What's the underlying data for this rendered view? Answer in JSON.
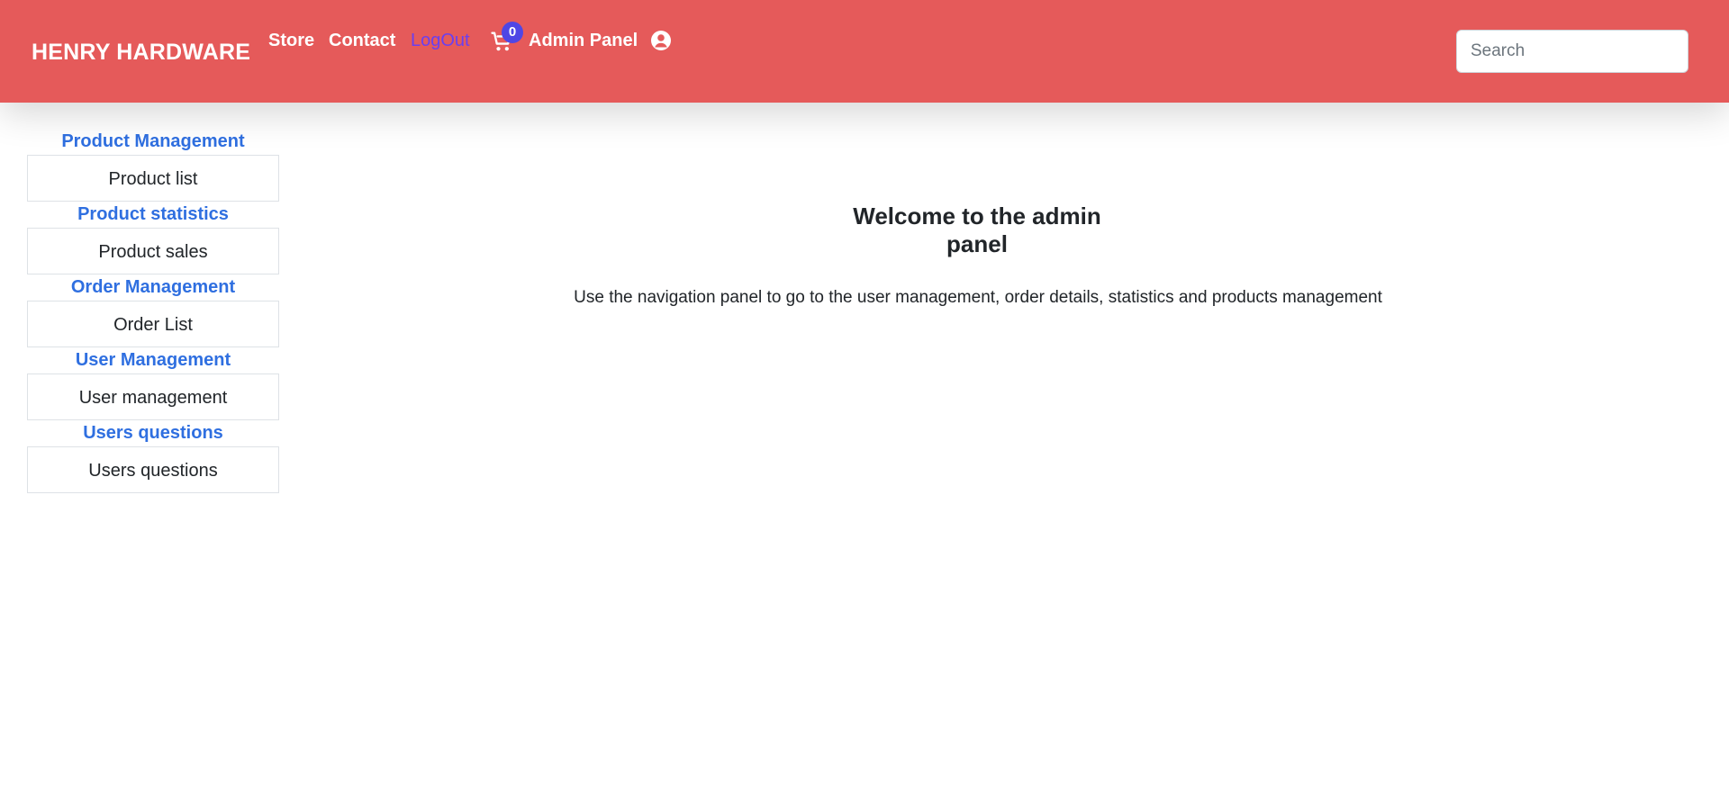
{
  "navbar": {
    "brand": "HENRY HARDWARE",
    "links": {
      "store": "Store",
      "contact": "Contact",
      "logout": "LogOut",
      "admin_panel": "Admin Panel"
    },
    "cart_count": "0",
    "search_placeholder": "Search",
    "colors": {
      "background": "#e55a5a",
      "logout": "#6a3ff0",
      "badge": "#4f46e5"
    },
    "icons": [
      "cart-icon",
      "user-circle-icon"
    ]
  },
  "sidebar": {
    "sections": [
      {
        "title": "Product Management",
        "button": "Product list"
      },
      {
        "title": "Product statistics",
        "button": "Product sales"
      },
      {
        "title": "Order Management",
        "button": "Order List"
      },
      {
        "title": "User Management",
        "button": "User management"
      },
      {
        "title": "Users questions",
        "button": "Users questions"
      }
    ],
    "title_color": "#2f6fe0"
  },
  "main": {
    "title": "Welcome to the admin panel",
    "description": "Use the navigation panel to go to the user management, order details, statistics and products management"
  }
}
